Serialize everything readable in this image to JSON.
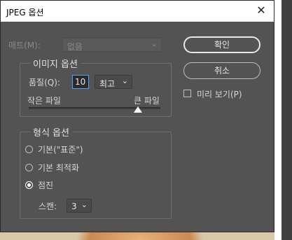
{
  "window": {
    "title": "JPEG 옵션",
    "close_glyph": "✕"
  },
  "matte": {
    "label": "매트(M):",
    "value": "없음"
  },
  "image_options": {
    "legend": "이미지 옵션",
    "quality_label": "품질(Q):",
    "quality_value": "10",
    "quality_preset": "최고",
    "small_file_label": "작은 파일",
    "large_file_label": "큰 파일",
    "quality_slider_value": 10,
    "quality_slider_max": 12
  },
  "format_options": {
    "legend": "형식 옵션",
    "options": [
      {
        "label": "기본(\"표준\")",
        "checked": false
      },
      {
        "label": "기본 최적화",
        "checked": false
      },
      {
        "label": "점진",
        "checked": true
      }
    ],
    "scan_label": "스캔:",
    "scan_value": "3"
  },
  "buttons": {
    "ok": "확인",
    "cancel": "취소"
  },
  "preview": {
    "label": "미리 보기(P)",
    "checked": false
  },
  "icons": {
    "dropdown": "chevron-down-icon",
    "close": "close-icon"
  },
  "colors": {
    "dialog_bg": "#535353",
    "focus_blue": "#4aa3ff",
    "title_bg": "#ffffff"
  }
}
